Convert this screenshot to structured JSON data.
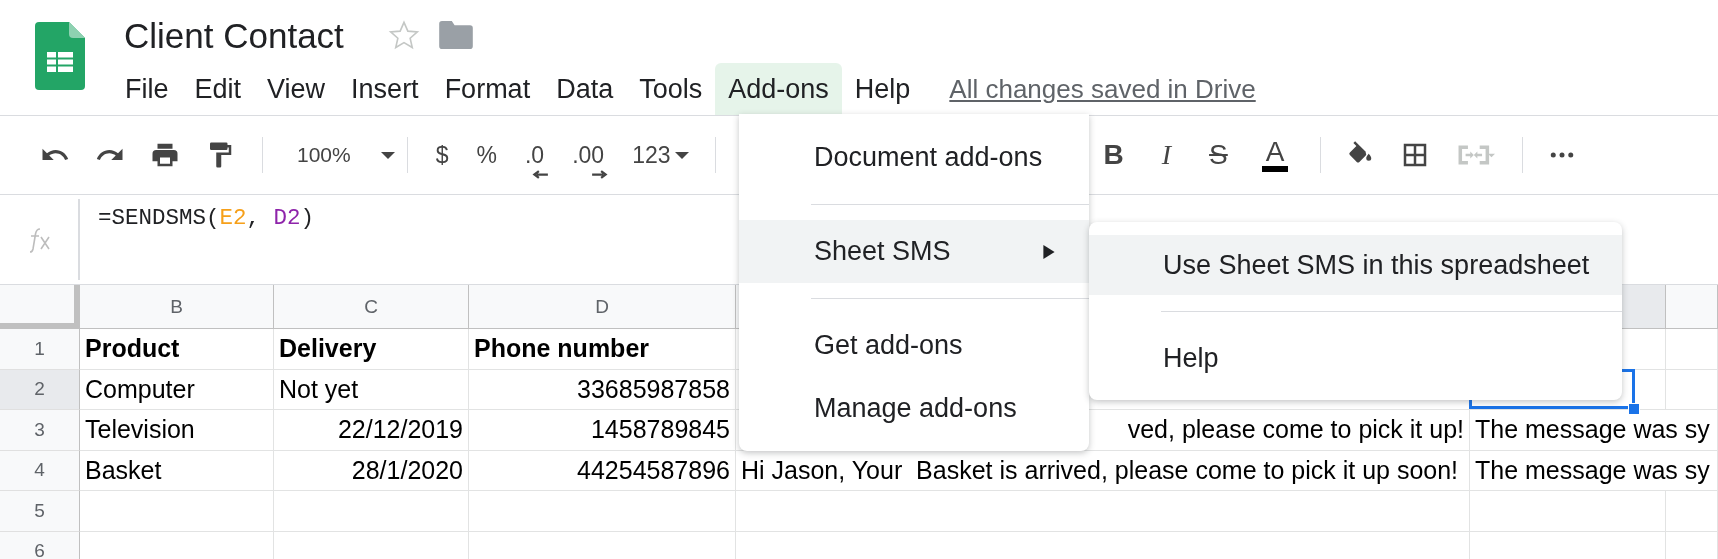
{
  "document": {
    "title": "Client Contact",
    "starred": false
  },
  "menu_bar": [
    {
      "label": "File",
      "selected": false
    },
    {
      "label": "Edit",
      "selected": false
    },
    {
      "label": "View",
      "selected": false
    },
    {
      "label": "Insert",
      "selected": false
    },
    {
      "label": "Format",
      "selected": false
    },
    {
      "label": "Data",
      "selected": false
    },
    {
      "label": "Tools",
      "selected": false
    },
    {
      "label": "Add-ons",
      "selected": true
    },
    {
      "label": "Help",
      "selected": false
    }
  ],
  "save_status": "All changes saved in Drive",
  "toolbar": {
    "zoom": "100%",
    "number_formats": [
      "$",
      "%",
      ".0",
      ".00",
      "123"
    ],
    "text_styles": [
      "B",
      "I",
      "S",
      "A"
    ],
    "merge_disabled": true
  },
  "formula": [
    {
      "text": "=SENDSMS(",
      "color": "#202124"
    },
    {
      "text": "E2",
      "color": "#f6a01a"
    },
    {
      "text": ", ",
      "color": "#202124"
    },
    {
      "text": "D2",
      "color": "#8e24aa"
    },
    {
      "text": ")",
      "color": "#202124"
    }
  ],
  "columns": [
    "B",
    "C",
    "D"
  ],
  "rows": [
    {
      "number": "1",
      "selected": false,
      "bold": true,
      "cells": [
        {
          "text": "Product",
          "kind": "text"
        },
        {
          "text": "Delivery",
          "kind": "text"
        },
        {
          "text": "Phone number",
          "kind": "text"
        },
        null,
        null,
        null
      ]
    },
    {
      "number": "2",
      "selected": true,
      "bold": false,
      "cells": [
        {
          "text": "Computer",
          "kind": "text"
        },
        {
          "text": "Not yet",
          "kind": "text"
        },
        {
          "text": "33685987858",
          "kind": "number"
        },
        null,
        {
          "selected": true
        },
        null
      ]
    },
    {
      "number": "3",
      "selected": false,
      "bold": false,
      "cells": [
        {
          "text": "Television",
          "kind": "text"
        },
        {
          "text": "22/12/2019",
          "kind": "number"
        },
        {
          "text": "1458789845",
          "kind": "number"
        },
        {
          "text": "ved, please come to pick it up!",
          "kind": "clipped"
        },
        {
          "text": "The message was sy",
          "kind": "text"
        },
        null
      ]
    },
    {
      "number": "4",
      "selected": false,
      "bold": false,
      "cells": [
        {
          "text": "Basket",
          "kind": "text"
        },
        {
          "text": "28/1/2020",
          "kind": "number"
        },
        {
          "text": "44254587896",
          "kind": "number"
        },
        {
          "text": "Hi Jason, Your  Basket is arrived, please come to pick it up soon!",
          "kind": "text"
        },
        {
          "text": "The message was sy",
          "kind": "text"
        },
        null
      ]
    },
    {
      "number": "5",
      "selected": false,
      "cells": [
        null,
        null,
        null,
        null,
        null,
        null
      ]
    },
    {
      "number": "6",
      "selected": false,
      "cells": [
        null,
        null,
        null,
        null,
        null,
        null
      ]
    }
  ],
  "addons_menu": [
    {
      "label": "Document add-ons",
      "kind": "item",
      "selected": false
    },
    {
      "kind": "separator"
    },
    {
      "label": "Sheet SMS",
      "kind": "submenu",
      "selected": true
    },
    {
      "kind": "separator"
    },
    {
      "label": "Get add-ons",
      "kind": "item",
      "selected": false
    },
    {
      "label": "Manage add-ons",
      "kind": "item",
      "selected": false
    }
  ],
  "submenu": [
    {
      "label": "Use Sheet SMS in this spreadsheet",
      "kind": "item",
      "selected": true
    },
    {
      "kind": "separator"
    },
    {
      "label": "Help",
      "kind": "item",
      "selected": false
    }
  ]
}
